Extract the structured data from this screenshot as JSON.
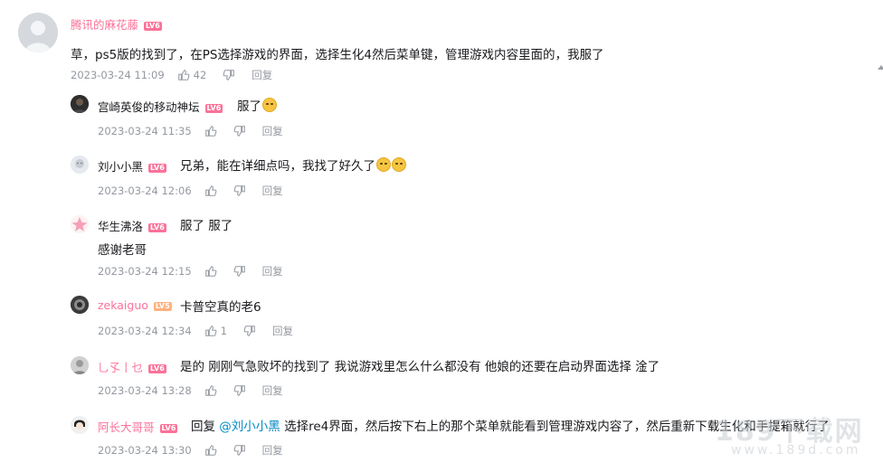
{
  "main_comment": {
    "user": "腾讯的麻花藤",
    "level": "LV6",
    "text": "草，ps5版的找到了，在PS选择游戏的界面，选择生化4然后菜单键，管理游戏内容里面的，我服了",
    "time": "2023-03-24 11:09",
    "likes": "42",
    "reply_label": "回复"
  },
  "replies": [
    {
      "user": "宫崎英俊的移动神坛",
      "level": "LV6",
      "text": "服了",
      "emoji": 1,
      "time": "2023-03-24 11:35",
      "likes": "",
      "reply_label": "回复"
    },
    {
      "user": "刘小小黑",
      "level": "LV6",
      "text": "兄弟，能在详细点吗，我找了好久了",
      "emoji": 2,
      "time": "2023-03-24 12:06",
      "likes": "",
      "reply_label": "回复"
    },
    {
      "user": "华生沸洛",
      "level": "LV6",
      "text": "服了 服了",
      "text2": "感谢老哥",
      "time": "2023-03-24 12:15",
      "likes": "",
      "reply_label": "回复"
    },
    {
      "user": "zekaiguo",
      "level": "LV5",
      "text": "卡普空真的老6",
      "time": "2023-03-24 12:34",
      "likes": "1",
      "reply_label": "回复"
    },
    {
      "user": "乚孓丨乜",
      "level": "LV6",
      "text": "是的 刚刚气急败坏的找到了 我说游戏里怎么什么都没有 他娘的还要在启动界面选择 淦了",
      "time": "2023-03-24 13:28",
      "likes": "",
      "reply_label": "回复"
    },
    {
      "user": "阿长大哥哥",
      "level": "LV6",
      "prefix": "回复",
      "mention": "@刘小小黑",
      "text": "选择re4界面，然后按下右上的那个菜单就能看到管理游戏内容了，然后重新下载生化和手提箱就行了",
      "time": "2023-03-24 13:30",
      "likes": "",
      "reply_label": "回复"
    }
  ],
  "watermark": {
    "main": "189下载网",
    "sub": "www.189d.com"
  },
  "colors": {
    "username_pink": "#fb7299",
    "lv6": "#fb7299",
    "lv5": "#ffb27f",
    "meta_gray": "#9499a0",
    "mention_blue": "#008ac5"
  }
}
